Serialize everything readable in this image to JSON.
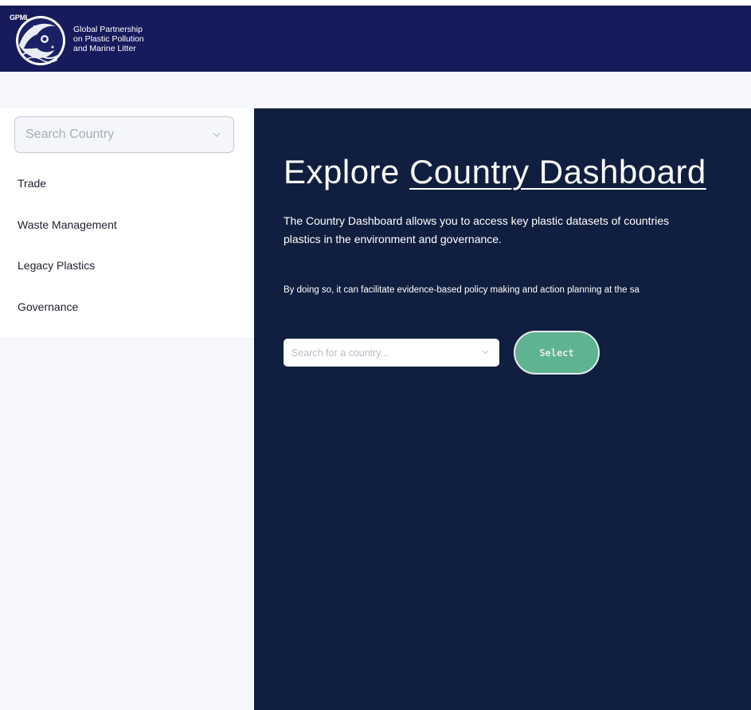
{
  "header": {
    "logo_tag": "GPML",
    "org_name_lines": [
      "Global Partnership",
      "on Plastic Pollution",
      "and Marine Litter"
    ]
  },
  "sidebar": {
    "country_select_placeholder": "Search Country",
    "items": [
      {
        "label": "Trade"
      },
      {
        "label": "Waste Management"
      },
      {
        "label": "Legacy Plastics"
      },
      {
        "label": "Governance"
      }
    ]
  },
  "main": {
    "title_prefix": "Explore",
    "title_link": "Country Dashboard",
    "intro_line1": "The Country Dashboard allows you to access key plastic datasets of countries",
    "intro_line2": "plastics in the environment and governance.",
    "sub_intro": "By doing so, it can facilitate evidence-based policy making and action planning at the sa",
    "search_placeholder": "Search for a country...",
    "select_label": "Select"
  },
  "colors": {
    "header_bg": "#161b5c",
    "main_bg": "#101f3f",
    "accent_green": "#67c49a",
    "sidebar_bg": "#f5f7fb"
  },
  "icons": {
    "logo": "gpml-wave-globe-logo",
    "dropdown": "chevron-down-icon"
  }
}
